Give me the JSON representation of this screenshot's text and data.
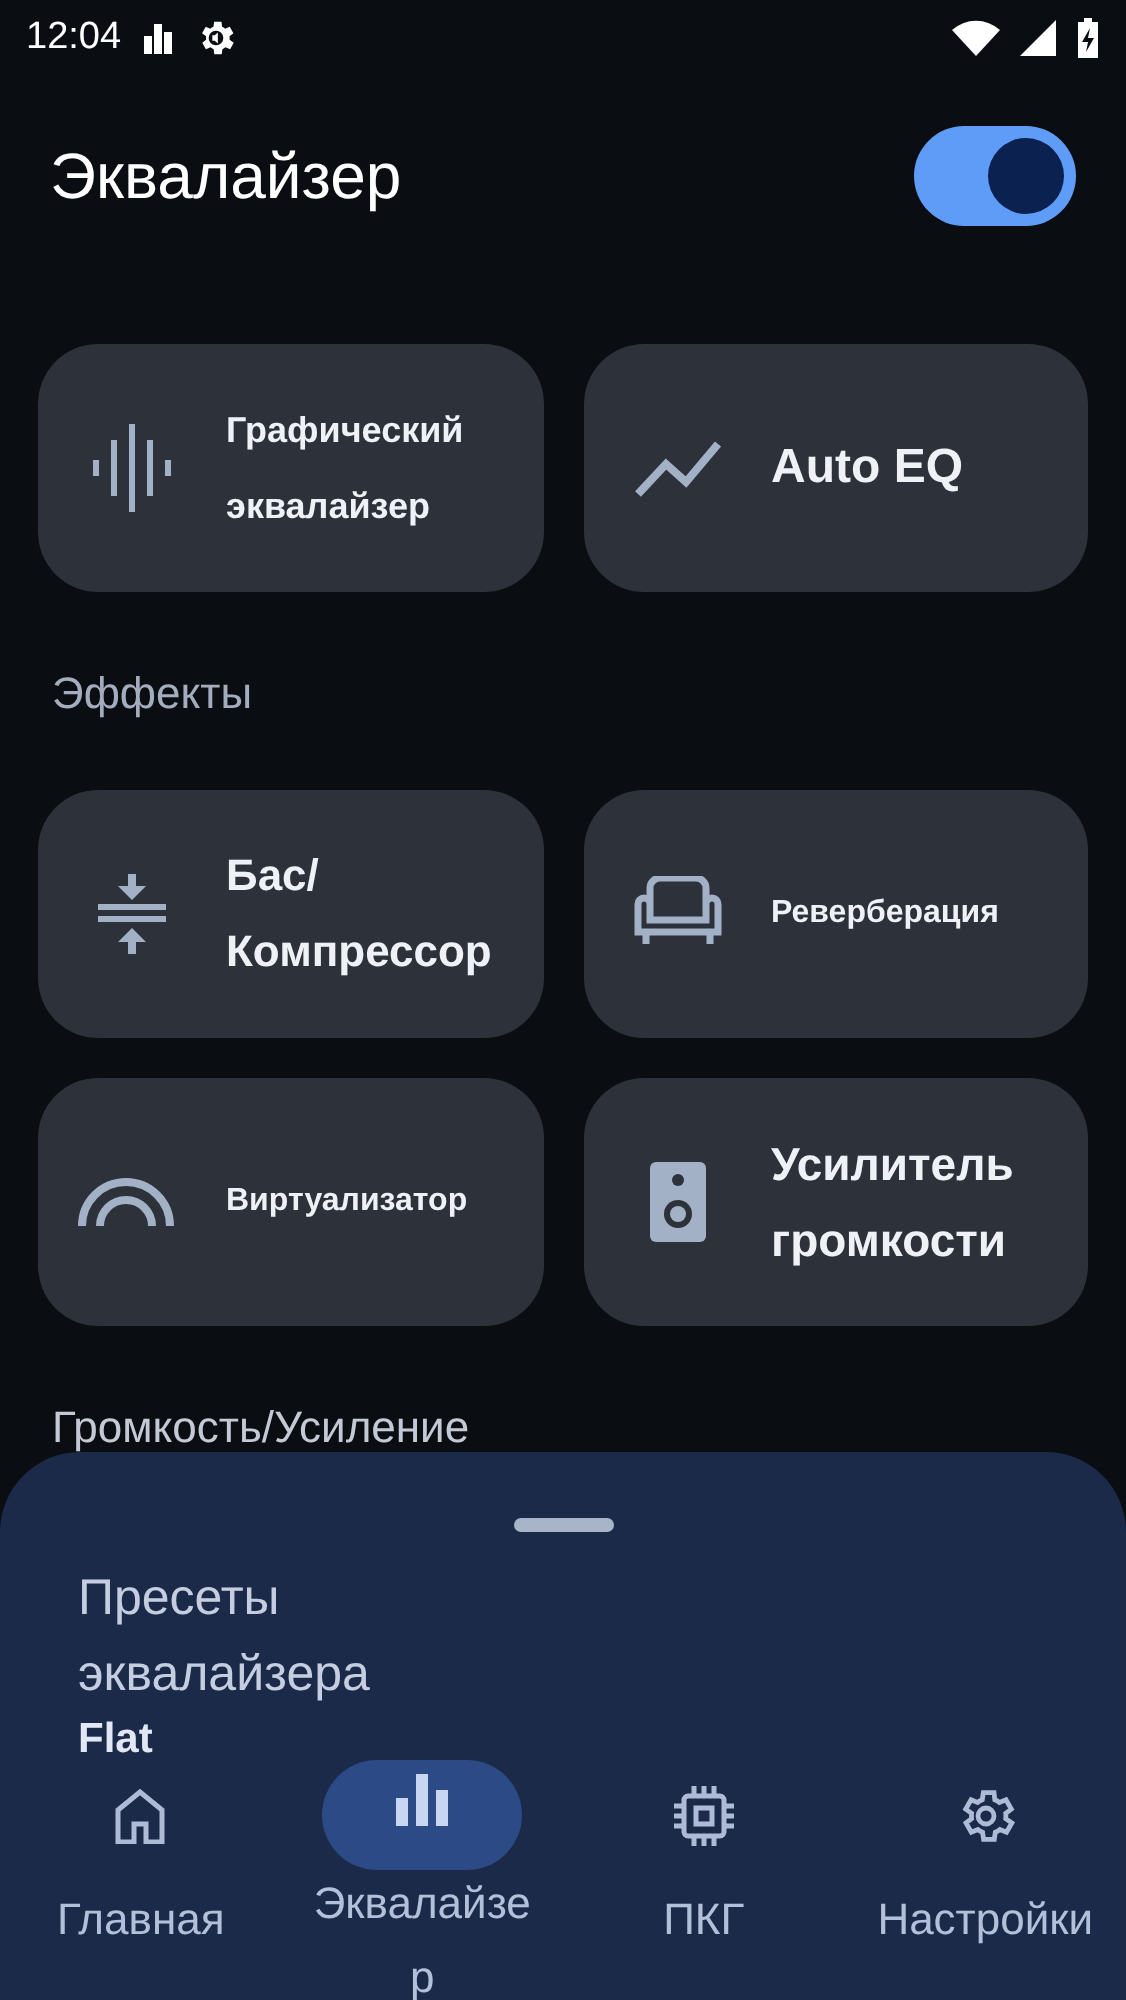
{
  "status_bar": {
    "time": "12:04"
  },
  "header": {
    "title": "Эквалайзер",
    "enabled": true
  },
  "tools": [
    {
      "label": "Графический эквалайзер"
    },
    {
      "label": "Auto EQ"
    }
  ],
  "sections": [
    {
      "title": "Эффекты",
      "cards": [
        {
          "label": "Бас/ Компрессор"
        },
        {
          "label": "Реверберация"
        },
        {
          "label": "Виртуализатор"
        },
        {
          "label": "Усилитель громкости"
        }
      ]
    },
    {
      "title": "Громкость/Усиление"
    }
  ],
  "presets_sheet": {
    "title": "Пресеты эквалайзера",
    "value": "Flat"
  },
  "bottom_nav": [
    {
      "label": "Главная",
      "selected": false
    },
    {
      "label": "Эквалайзер",
      "selected": true
    },
    {
      "label": "ПКГ",
      "selected": false
    },
    {
      "label": "Настройки",
      "selected": false
    }
  ]
}
